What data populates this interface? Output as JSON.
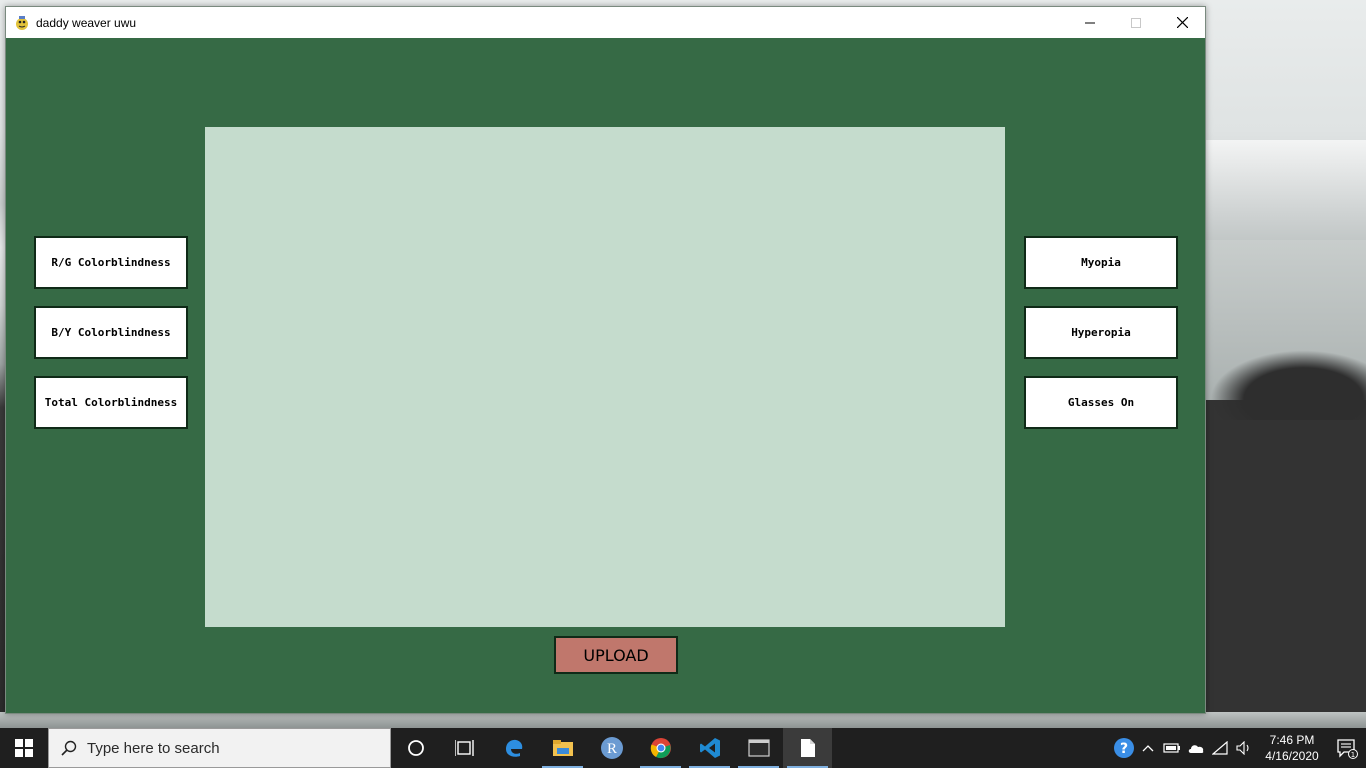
{
  "window": {
    "title": "daddy weaver uwu"
  },
  "left_buttons": [
    {
      "label": "R/G Colorblindness"
    },
    {
      "label": "B/Y Colorblindness"
    },
    {
      "label": "Total Colorblindness"
    }
  ],
  "right_buttons": [
    {
      "label": "Myopia"
    },
    {
      "label": "Hyperopia"
    },
    {
      "label": "Glasses On"
    }
  ],
  "upload": {
    "label": "UPLOAD"
  },
  "colors": {
    "window_bg": "#366a45",
    "canvas_bg": "#c5dccd",
    "button_bg": "#ffffff",
    "upload_bg": "#c0776c"
  },
  "taskbar": {
    "search_placeholder": "Type here to search",
    "pinned": [
      "cortana-icon",
      "task-view-icon",
      "edge-icon",
      "file-explorer-icon",
      "r-icon",
      "chrome-icon",
      "vscode-icon",
      "terminal-icon",
      "document-icon"
    ],
    "time": "7:46 PM",
    "date": "4/16/2020",
    "notification_count": "1"
  }
}
